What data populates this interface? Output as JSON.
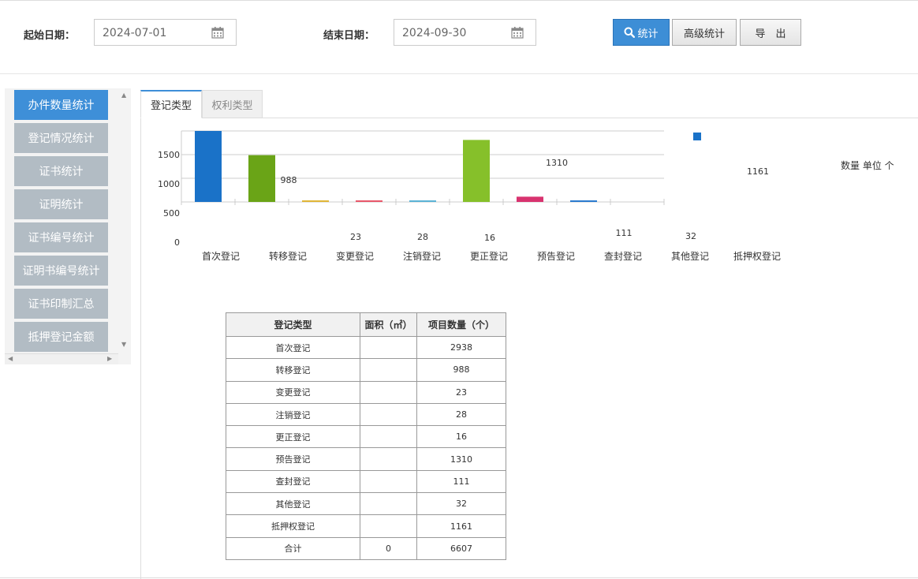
{
  "toolbar": {
    "start_label": "起始日期：",
    "start_value": "2024-07-01",
    "end_label": "结束日期：",
    "end_value": "2024-09-30",
    "stat_button": "统计",
    "advanced_button": "高级统计",
    "export_button": "导　出"
  },
  "sidebar": {
    "items": [
      {
        "label": "办件数量统计"
      },
      {
        "label": "登记情况统计"
      },
      {
        "label": "证书统计"
      },
      {
        "label": "证明统计"
      },
      {
        "label": "证书编号统计"
      },
      {
        "label": "证明书编号统计"
      },
      {
        "label": "证书印制汇总"
      },
      {
        "label": "抵押登记金额"
      }
    ]
  },
  "tabs": [
    {
      "label": "登记类型"
    },
    {
      "label": "权利类型"
    }
  ],
  "unit_label": "数量 单位 个",
  "colors": {
    "accent": "#3e8fd8",
    "sidebar_inactive": "#b2bcc4"
  },
  "chart_data": {
    "type": "bar",
    "categories": [
      "首次登记",
      "转移登记",
      "变更登记",
      "注销登记",
      "更正登记",
      "预告登记",
      "查封登记",
      "其他登记",
      "抵押权登记"
    ],
    "values": [
      2938,
      988,
      23,
      28,
      16,
      1310,
      111,
      32,
      1161
    ],
    "bar_colors": [
      "#1a72c8",
      "#6aa417",
      "#e1b637",
      "#e8586a",
      "#5bb3d6",
      "#86c02a",
      "#d8336f",
      "#2b7bcf",
      "#6aa417"
    ],
    "yticks": [
      0,
      500,
      1000,
      1500
    ],
    "value_labels": [
      "",
      "988",
      "23",
      "28",
      "16",
      "1310",
      "111",
      "32",
      "1161"
    ]
  },
  "table": {
    "headers": [
      "登记类型",
      "面积（㎡）",
      "项目数量（个）"
    ],
    "rows": [
      {
        "type": "首次登记",
        "area": "",
        "count": "2938"
      },
      {
        "type": "转移登记",
        "area": "",
        "count": "988"
      },
      {
        "type": "变更登记",
        "area": "",
        "count": "23"
      },
      {
        "type": "注销登记",
        "area": "",
        "count": "28"
      },
      {
        "type": "更正登记",
        "area": "",
        "count": "16"
      },
      {
        "type": "预告登记",
        "area": "",
        "count": "1310"
      },
      {
        "type": "查封登记",
        "area": "",
        "count": "111"
      },
      {
        "type": "其他登记",
        "area": "",
        "count": "32"
      },
      {
        "type": "抵押权登记",
        "area": "",
        "count": "1161"
      },
      {
        "type": "合计",
        "area": "0",
        "count": "6607"
      }
    ]
  }
}
